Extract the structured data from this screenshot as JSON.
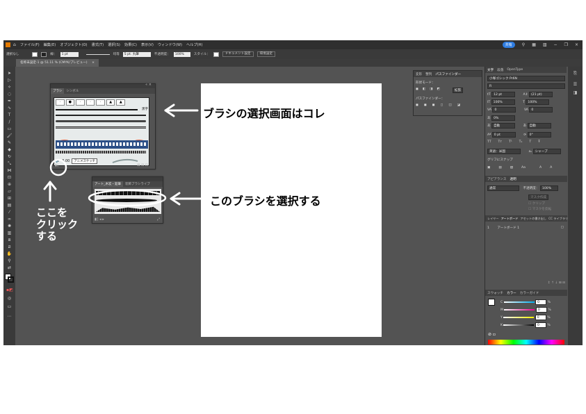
{
  "menubar": {
    "items": [
      "ファイル(F)",
      "編集(E)",
      "オブジェクト(O)",
      "書式(T)",
      "選択(S)",
      "効果(C)",
      "表示(V)",
      "ウィンドウ(W)",
      "ヘルプ(H)"
    ],
    "share_label": "共有"
  },
  "optionbar": {
    "selection_label": "選択なし",
    "stroke_label": "線：",
    "stroke_value": "1 pt",
    "uniform_label": "均等",
    "brush_label": "5 pt. 丸筆",
    "opacity_label": "不透明度：",
    "opacity_value": "100%",
    "style_label": "スタイル：",
    "doc_setup_label": "ドキュメント設定",
    "prefs_label": "環境設定"
  },
  "document_tab": {
    "title": "名称未設定-1 @ 51.11 % (CMYK/プレビュー)",
    "close": "×"
  },
  "brush_panel": {
    "tabs": [
      "ブラシ",
      "シンボル"
    ],
    "row_label": "黒字",
    "size_value": "6.00",
    "tooltip": "アニメスケッチ"
  },
  "art_brush_panel": {
    "tabs": [
      "アート_木炭・鉛筆",
      "装飾ブラシライブ"
    ]
  },
  "pathfinder_panel": {
    "tabs": [
      "変形",
      "整列",
      "パスファインダー"
    ],
    "shape_mode_label": "形状モード：",
    "expand_label": "拡張",
    "pathfinder_label": "パスファインダー："
  },
  "character_panel": {
    "tabs": [
      "文字",
      "段落",
      "OpenType"
    ],
    "font_family": "小塚ゴシック Pr6N",
    "font_style": "R",
    "size_value": "12 pt",
    "leading_value": "(21 pt)",
    "vscale_value": "100%",
    "hscale_value": "100%",
    "tracking_value": "0",
    "kerning_value": "0",
    "tsume_value": "0%",
    "auto_label": "自動",
    "aki_label": "自動",
    "baseline_value": "0 pt",
    "rotate_value": "0°",
    "lang_value": "英語：米国",
    "aa_value": "シャープ",
    "glyph_snap_label": "グリフにスナップ"
  },
  "appearance_panel": {
    "tabs": [
      "アピアランス",
      "透明"
    ],
    "blend_mode": "通常",
    "opacity_label": "不透明度：",
    "opacity_value": "100%",
    "mask_button": "マスク作成",
    "clip_label": "クリップ",
    "invert_label": "マスクを反転"
  },
  "layers_panel": {
    "tabs": [
      "レイヤー",
      "アートボード",
      "アセットの書き出し",
      "CC ライブラリ"
    ],
    "artboard_index": "1",
    "artboard_name": "アートボード 1"
  },
  "color_panel": {
    "tabs": [
      "スウォッチ",
      "カラー",
      "カラーガイド"
    ],
    "channels": [
      {
        "label": "C",
        "value": "0",
        "unit": "%"
      },
      {
        "label": "M",
        "value": "0",
        "unit": "%"
      },
      {
        "label": "Y",
        "value": "0",
        "unit": "%"
      },
      {
        "label": "K",
        "value": "0",
        "unit": "%"
      }
    ]
  },
  "annotations": {
    "arrow1_text": "ブラシの選択画面はコレ",
    "arrow2_text": "このブラシを選択する",
    "click_text_lines": [
      "ここを",
      "クリック",
      "する"
    ]
  },
  "colors": {
    "ui_dark": "#2f2f2f",
    "ui_mid": "#535353",
    "accent_blue": "#2f7de1",
    "brush_selected": "#2c4f86",
    "brush_red": "#e2542f"
  }
}
